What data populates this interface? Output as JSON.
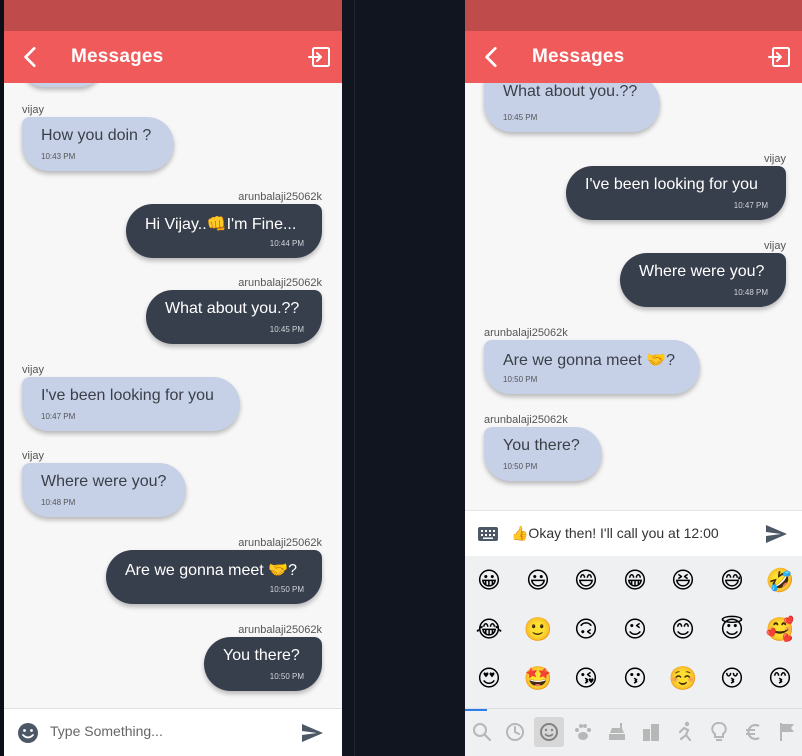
{
  "header": {
    "title": "Messages"
  },
  "left_chat": [
    {
      "sender": "vijay",
      "text": "How you doin ?",
      "time": "10:43 PM",
      "dir": "in"
    },
    {
      "sender": "arunbalaji25062k",
      "text": "Hi Vijay..👊I'm Fine...",
      "time": "10:44 PM",
      "dir": "out"
    },
    {
      "sender": "arunbalaji25062k",
      "text": "What about you.??",
      "time": "10:45 PM",
      "dir": "out"
    },
    {
      "sender": "vijay",
      "text": "I've been looking for you",
      "time": "10:47 PM",
      "dir": "in"
    },
    {
      "sender": "vijay",
      "text": "Where were you?",
      "time": "10:48 PM",
      "dir": "in"
    },
    {
      "sender": "arunbalaji25062k",
      "text": "Are we gonna meet 🤝?",
      "time": "10:50 PM",
      "dir": "out"
    },
    {
      "sender": "arunbalaji25062k",
      "text": "You there?",
      "time": "10:50 PM",
      "dir": "out"
    }
  ],
  "right_chat": [
    {
      "sender": "",
      "text": "What about you.??",
      "time": "10:45 PM",
      "dir": "in"
    },
    {
      "sender": "vijay",
      "text": "I've been looking for you",
      "time": "10:47 PM",
      "dir": "out"
    },
    {
      "sender": "vijay",
      "text": "Where were you?",
      "time": "10:48 PM",
      "dir": "out"
    },
    {
      "sender": "arunbalaji25062k",
      "text": "Are we gonna meet 🤝?",
      "time": "10:50 PM",
      "dir": "in"
    },
    {
      "sender": "arunbalaji25062k",
      "text": "You there?",
      "time": "10:50 PM",
      "dir": "in"
    }
  ],
  "left_input": {
    "placeholder": "Type Something..."
  },
  "right_input": {
    "value": "👍Okay then! I'll call you at 12:00"
  },
  "emoji_rows": [
    [
      "😀",
      "😃",
      "😄",
      "😁",
      "😆",
      "😅",
      "🤣"
    ],
    [
      "😂",
      "🙂",
      "🙃",
      "😉",
      "😊",
      "😇",
      "🥰"
    ],
    [
      "😍",
      "🤩",
      "😘",
      "😗",
      "☺️",
      "😚",
      "😙"
    ]
  ],
  "emoji_categories": [
    "search-icon",
    "recent-icon",
    "smiley-icon",
    "paw-icon",
    "food-icon",
    "buildings-icon",
    "activity-icon",
    "lightbulb-icon",
    "euro-icon",
    "flag-icon"
  ],
  "colors": {
    "appbar": "#f05a5a",
    "statusbar": "#c04b4b",
    "bubble_in": "#c6d1e8",
    "bubble_out": "#383f4c"
  }
}
